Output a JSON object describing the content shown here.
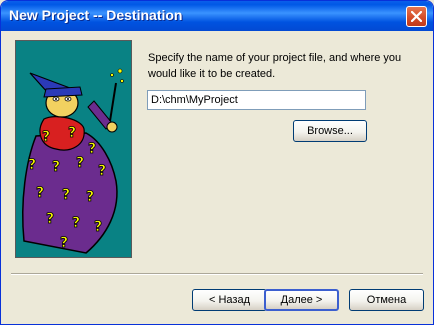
{
  "window": {
    "title": "New Project -- Destination"
  },
  "prompt": "Specify the name of your project file, and where you would like it to be created.",
  "path_field": {
    "value": "D:\\chm\\MyProject"
  },
  "buttons": {
    "browse_label": "Browse...",
    "back_label": "< Назад",
    "next_label": "Далее >",
    "cancel_label": "Отмена"
  },
  "icons": {
    "close": "close-icon",
    "wizard": "wizard-illustration"
  },
  "colors": {
    "titlebar": "#0058E6",
    "dialog_bg": "#ECE9D8",
    "art_bg": "#098284",
    "robe": "#6B2C8E",
    "hat": "#2B3AB8",
    "beard": "#D82020",
    "question_marks": "#FFFF00"
  }
}
